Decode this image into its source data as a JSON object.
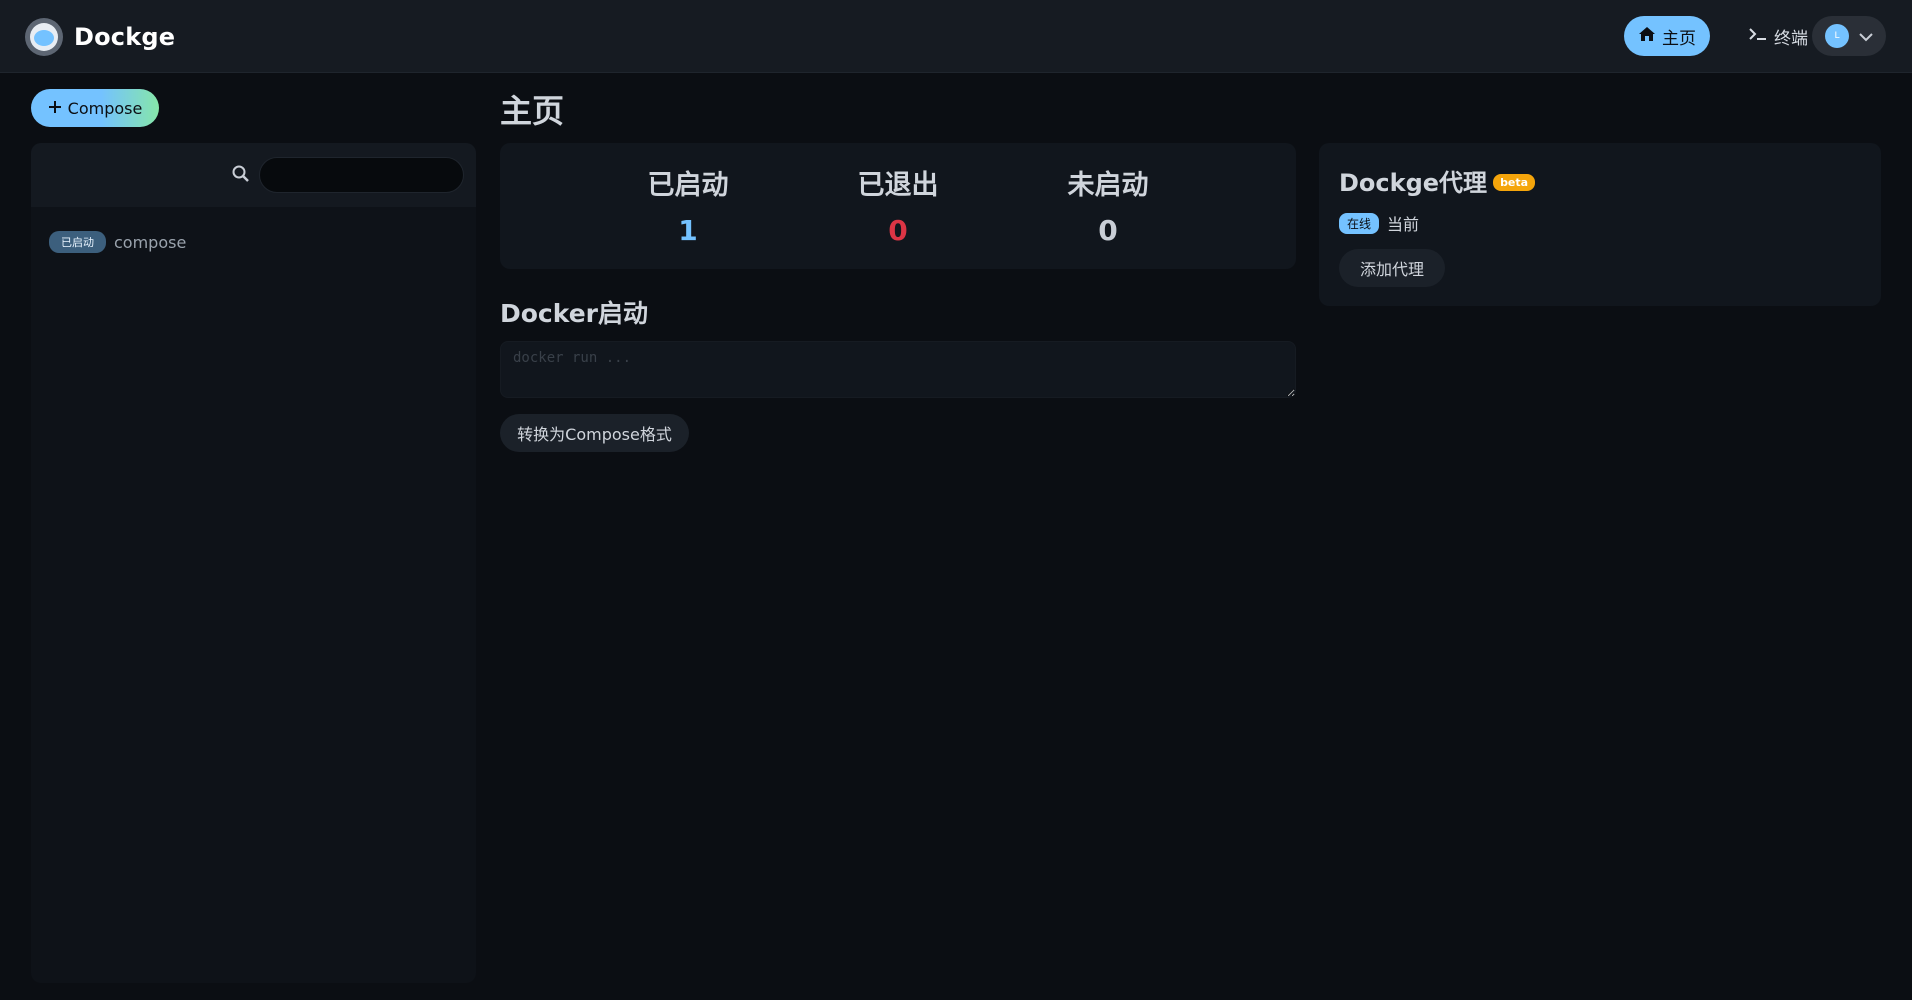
{
  "header": {
    "brand": "Dockge",
    "nav": {
      "home_label": "主页",
      "terminal_label": "终端"
    },
    "profile": {
      "avatar_initial": "L"
    }
  },
  "sidebar": {
    "compose_button_label": "Compose",
    "search": {
      "value": "",
      "placeholder": ""
    },
    "stacks": [
      {
        "status": "已启动",
        "name": "compose"
      }
    ]
  },
  "main": {
    "title": "主页",
    "stats": {
      "running": {
        "label": "已启动",
        "value": "1"
      },
      "exited": {
        "label": "已退出",
        "value": "0"
      },
      "inactive": {
        "label": "未启动",
        "value": "0"
      }
    },
    "agents": {
      "title": "Dockge代理",
      "beta_badge": "beta",
      "online_badge": "在线",
      "current_label": "当前",
      "add_button_label": "添加代理"
    },
    "docker_run": {
      "title": "Docker启动",
      "placeholder": "docker run ...",
      "value": "",
      "convert_button_label": "转换为Compose格式"
    }
  },
  "colors": {
    "accent": "#74c2ff",
    "running": "#74c2ff",
    "exited": "#dc3545",
    "inactive": "#c9ced6",
    "beta": "#f5a50b",
    "background": "#0b0e13",
    "card": "#11161d"
  },
  "icons": {
    "logo": "dockge-logo-icon",
    "home": "home-icon",
    "terminal": "terminal-icon",
    "search": "search-icon",
    "plus": "plus-icon",
    "chevron": "chevron-down-icon"
  }
}
